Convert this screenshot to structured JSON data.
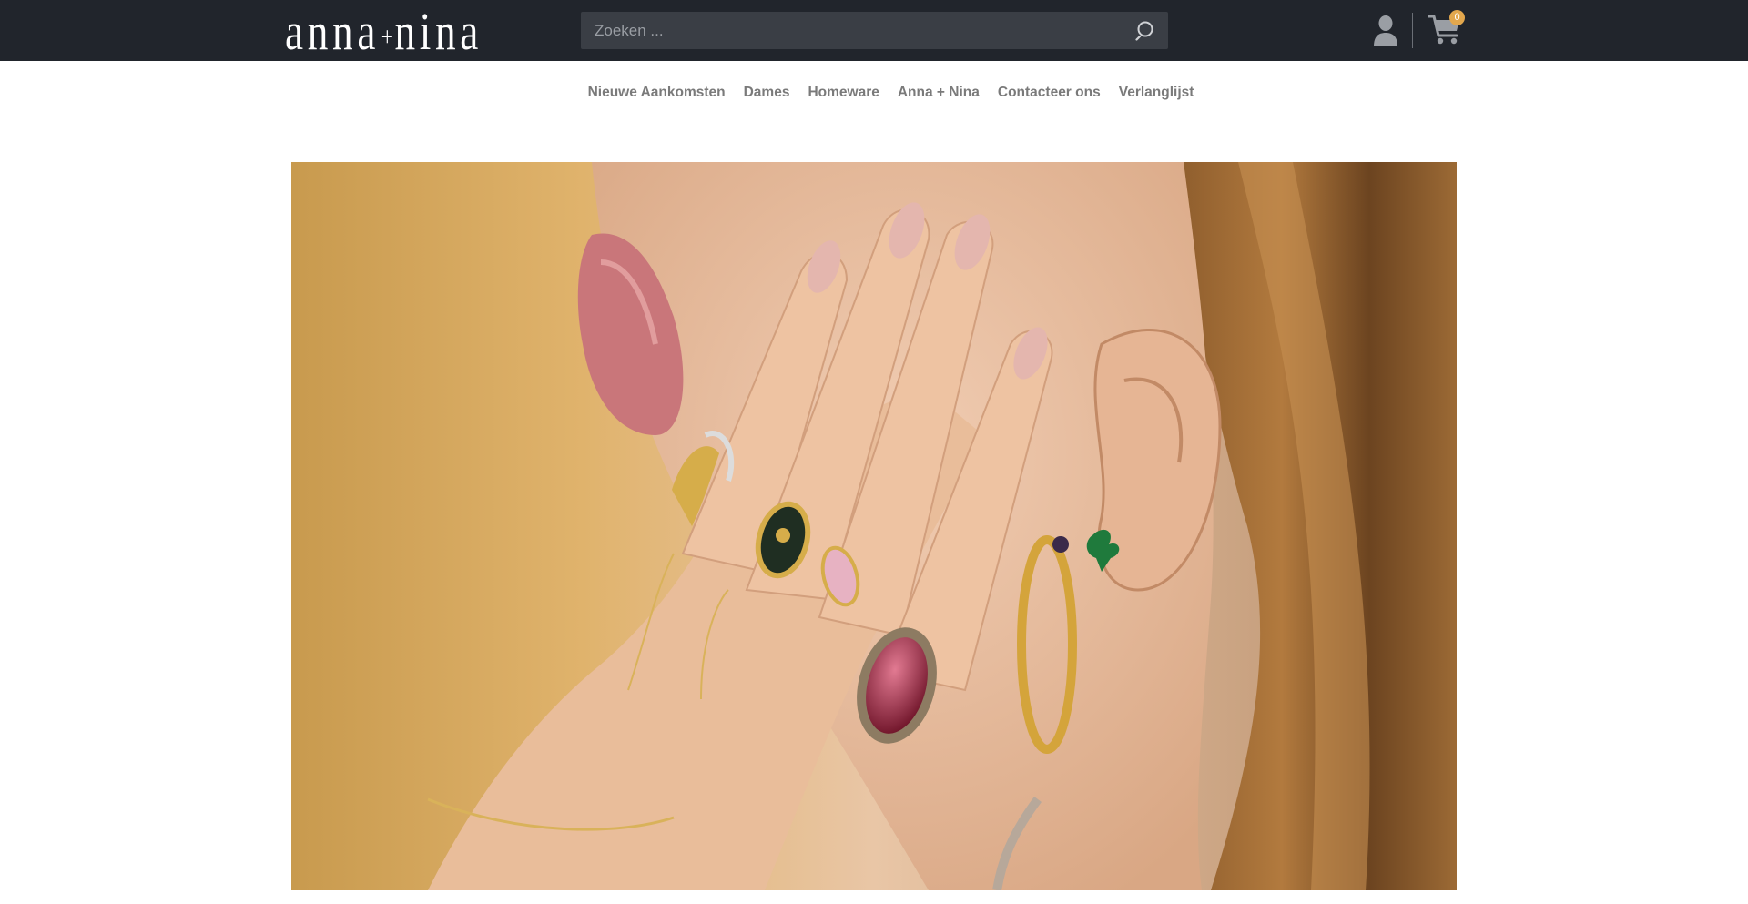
{
  "header": {
    "logo_left": "anna",
    "logo_plus": "+",
    "logo_right": "nina",
    "search_placeholder": "Zoeken ...",
    "cart_count": "0",
    "background": "#21252c",
    "accent": "#e2a74d"
  },
  "nav": {
    "items": [
      {
        "label": "Nieuwe Aankomsten"
      },
      {
        "label": "Dames"
      },
      {
        "label": "Homeware"
      },
      {
        "label": "Anna + Nina"
      },
      {
        "label": "Contacteer ons"
      },
      {
        "label": "Verlanglijst"
      }
    ]
  },
  "icons": {
    "search": "search-icon",
    "user": "user-icon",
    "cart": "cart-icon"
  }
}
